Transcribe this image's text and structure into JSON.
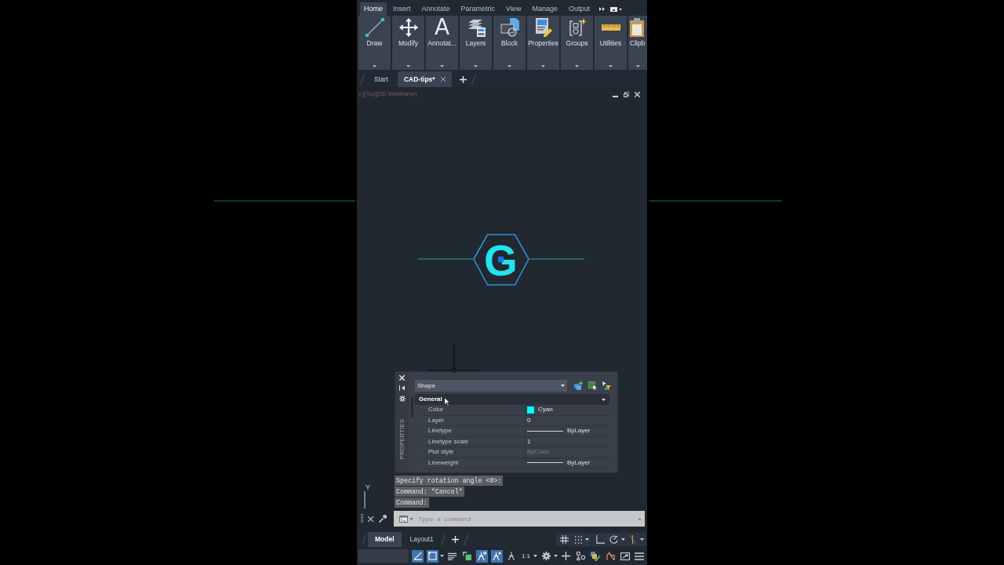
{
  "ribbon": {
    "tabs": [
      {
        "label": "Home",
        "selected": true
      },
      {
        "label": "Insert",
        "selected": false
      },
      {
        "label": "Annotate",
        "selected": false
      },
      {
        "label": "Parametric",
        "selected": false
      },
      {
        "label": "View",
        "selected": false
      },
      {
        "label": "Manage",
        "selected": false
      },
      {
        "label": "Output",
        "selected": false
      }
    ],
    "panels": [
      {
        "label": "Draw",
        "kind": "draw"
      },
      {
        "label": "Modify",
        "kind": "modify"
      },
      {
        "label": "Annotat...",
        "kind": "text",
        "glyph": "A"
      },
      {
        "label": "Layers",
        "kind": "layers"
      },
      {
        "label": "Block",
        "kind": "block"
      },
      {
        "label": "Properties",
        "kind": "properties"
      },
      {
        "label": "Groups",
        "kind": "groups"
      },
      {
        "label": "Utilities",
        "kind": "utilities"
      },
      {
        "label": "Clipb",
        "kind": "clipboard"
      }
    ]
  },
  "file_tabs": [
    {
      "label": "Start",
      "selected": false,
      "closable": false
    },
    {
      "label": "CAD-tips*",
      "selected": true,
      "closable": true
    }
  ],
  "viewport": {
    "label": "[-][Top][2D Wireframe]",
    "logo": {
      "letter": "G"
    },
    "ucs": {
      "y_label": "Y"
    }
  },
  "properties": {
    "title": "PROPERTIES",
    "selection": "Shape",
    "section": {
      "label": "General",
      "expanded": true
    },
    "rows": [
      {
        "label": "Color",
        "value": "Cyan",
        "kind": "color",
        "color": "#00ffff",
        "disabled": false
      },
      {
        "label": "Layer",
        "value": "0",
        "kind": "text",
        "disabled": false
      },
      {
        "label": "Linetype",
        "value": "ByLayer",
        "kind": "line",
        "disabled": false
      },
      {
        "label": "Linetype scale",
        "value": "1",
        "kind": "text",
        "disabled": false
      },
      {
        "label": "Plot style",
        "value": "ByColor",
        "kind": "text",
        "disabled": true
      },
      {
        "label": "Lineweight",
        "value": "ByLayer",
        "kind": "line",
        "disabled": false
      }
    ]
  },
  "command": {
    "history": [
      "Specify rotation angle <0>:",
      "Command: *Cancel*",
      "Command:"
    ],
    "placeholder": "Type a command"
  },
  "layout_tabs": [
    {
      "label": "Model",
      "selected": true
    },
    {
      "label": "Layout1",
      "selected": false
    }
  ],
  "layout_tool_groups": [
    {
      "tools": [
        {
          "kind": "grid",
          "dropdown": false
        },
        {
          "kind": "snap",
          "dropdown": true
        }
      ]
    },
    {
      "tools": [
        {
          "kind": "ortho",
          "dropdown": false
        },
        {
          "kind": "polar",
          "dropdown": true
        },
        {
          "kind": "osnap",
          "dropdown": true
        }
      ]
    }
  ],
  "status_bar": {
    "tools": [
      {
        "kind": "angle",
        "on": true,
        "dropdown": false
      },
      {
        "kind": "box",
        "on": true,
        "dropdown": true
      },
      {
        "kind": "lineweight",
        "on": false,
        "dropdown": false
      },
      {
        "kind": "transparency",
        "on": false,
        "dropdown": false
      },
      {
        "kind": "annoscale",
        "on": true,
        "dropdown": false
      },
      {
        "kind": "autoscale",
        "on": true,
        "dropdown": false
      },
      {
        "kind": "annovisibility",
        "on": false,
        "dropdown": false
      },
      {
        "kind": "scale",
        "label": "1:1",
        "on": false,
        "dropdown": true
      },
      {
        "kind": "gear",
        "on": false,
        "dropdown": true
      },
      {
        "kind": "plus",
        "on": false,
        "dropdown": false
      },
      {
        "kind": "shapes",
        "on": false,
        "dropdown": false
      },
      {
        "kind": "layers",
        "on": false,
        "dropdown": false
      },
      {
        "kind": "house",
        "on": false,
        "dropdown": false
      },
      {
        "kind": "fullscreen",
        "on": false,
        "dropdown": false
      },
      {
        "kind": "menu",
        "on": false,
        "dropdown": false
      }
    ]
  }
}
